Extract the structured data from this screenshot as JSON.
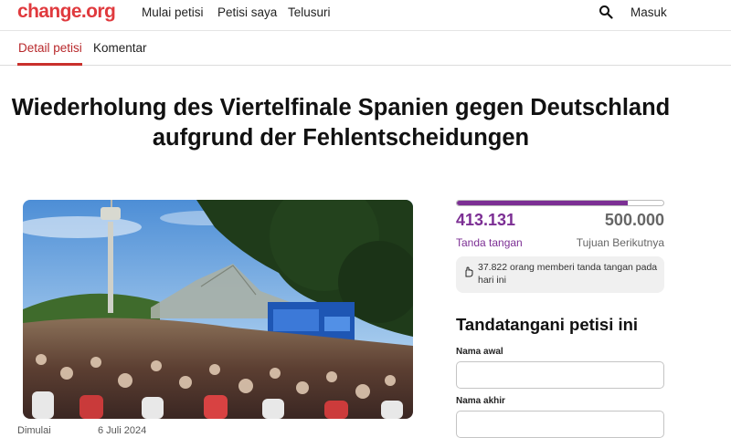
{
  "brand": {
    "logo": "change.org",
    "accent": "#e03a3e"
  },
  "nav": {
    "links": [
      "Mulai petisi",
      "Petisi saya",
      "Telusuri"
    ],
    "search_icon": "search-icon",
    "login": "Masuk"
  },
  "tabs": [
    {
      "label": "Detail petisi",
      "active": true
    },
    {
      "label": "Komentar",
      "active": false
    }
  ],
  "petition": {
    "title_line1": "Wiederholung des Viertelfinale Spanien gegen Deutschland",
    "title_line2": "aufgrund der Fehlentscheidungen",
    "started_label": "Dimulai",
    "started_date": "6 Juli 2024"
  },
  "progress": {
    "signatures": "413.131",
    "signatures_label": "Tanda tangan",
    "goal": "500.000",
    "goal_label": "Tujuan Berikutnya",
    "fraction": 0.826,
    "color": "#7c2f94",
    "today_text": "37.822 orang memberi tanda tangan pada hari ini",
    "today_icon": "hand-icon"
  },
  "form": {
    "heading": "Tandatangani petisi ini",
    "first_name_label": "Nama awal",
    "first_name_value": "",
    "last_name_label": "Nama akhir",
    "last_name_value": ""
  }
}
